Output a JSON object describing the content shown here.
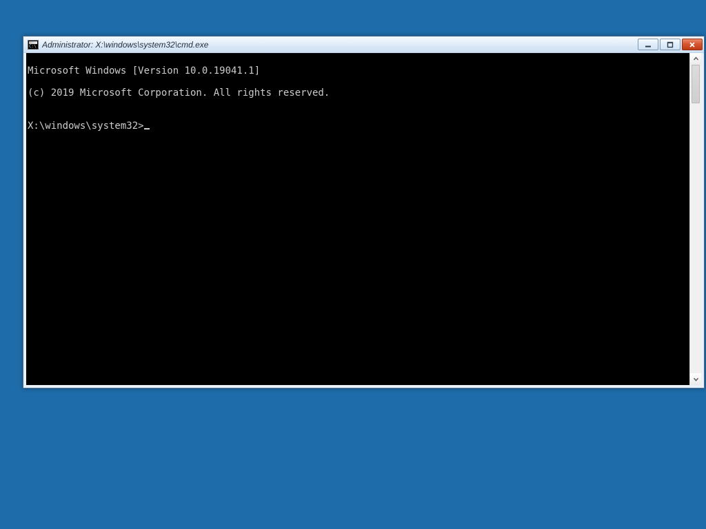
{
  "window": {
    "title": "Administrator: X:\\windows\\system32\\cmd.exe"
  },
  "terminal": {
    "line1": "Microsoft Windows [Version 10.0.19041.1]",
    "line2": "(c) 2019 Microsoft Corporation. All rights reserved.",
    "blank": "",
    "prompt": "X:\\windows\\system32>"
  },
  "colors": {
    "desktop": "#1e6ca9",
    "terminal_bg": "#000000",
    "terminal_fg": "#cccccc"
  }
}
